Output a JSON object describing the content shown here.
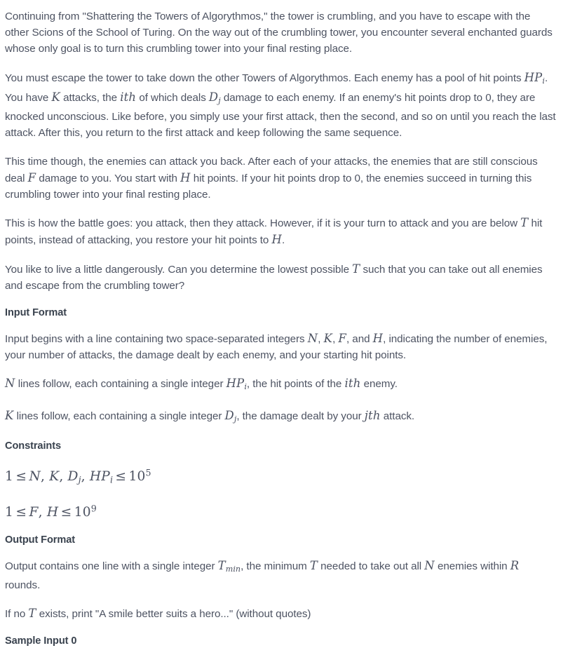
{
  "document": {
    "type": "programming-problem-statement",
    "body_color": "#4d5362",
    "heading_color": "#39424e",
    "background": "#ffffff"
  },
  "paragraphs": {
    "intro": "Continuing from \"Shattering the Towers of Algorythmos,\" the tower is crumbling, and you have to escape with the other Scions of the School of Turing. On the way out of the crumbling tower, you encounter several enchanted guards whose only goal is to turn this crumbling tower into your final resting place.",
    "mechanics_1": "You must escape the tower to take down the other Towers of Algorythmos. Each enemy has a pool of hit points ",
    "mechanics_2": ". You have ",
    "mechanics_3": " attacks, the ",
    "mechanics_4": " of which deals ",
    "mechanics_5": " damage to each enemy. If an enemy's hit points drop to 0, they are knocked unconscious. Like before, you simply use your first attack, then the second, and so on until you reach the last attack. After this, you return to the first attack and keep following the same sequence.",
    "enemies_1": "This time though, the enemies can attack you back. After each of your attacks, the enemies that are still conscious deal ",
    "enemies_2": " damage to you. You start with ",
    "enemies_3": " hit points. If your hit points drop to 0, the enemies succeed in turning this crumbling tower into your final resting place.",
    "battle_1": "This is how the battle goes: you attack, then they attack. However, if it is your turn to attack and you are below ",
    "battle_2": " hit points, instead of attacking, you restore your hit points to ",
    "battle_3": ".",
    "question_1": "You like to live a little dangerously. Can you determine the lowest possible ",
    "question_2": " such that you can take out all enemies and escape from the crumbling tower?"
  },
  "input_format": {
    "heading": "Input Format",
    "line1_a": "Input begins with a line containing two space-separated integers ",
    "line1_b": ", ",
    "line1_c": ", ",
    "line1_d": ", and ",
    "line1_e": ", indicating the number of enemies, your number of attacks, the damage dealt by each enemy, and your starting hit points.",
    "line2_a": " lines follow, each containing a single integer ",
    "line2_b": ", the hit points of the ",
    "line2_c": " enemy.",
    "line3_a": " lines follow, each containing a single integer ",
    "line3_b": ", the damage dealt by your ",
    "line3_c": " attack."
  },
  "constraints": {
    "heading": "Constraints",
    "line1": {
      "lower": "1",
      "vars": "N, K, D_j, HP_i",
      "upper_base": "10",
      "upper_exp": "5"
    },
    "line2": {
      "lower": "1",
      "vars": "F, H",
      "upper_base": "10",
      "upper_exp": "9"
    }
  },
  "output_format": {
    "heading": "Output Format",
    "line1_a": "Output contains one line with a single integer ",
    "line1_b": ", the minimum ",
    "line1_c": " needed to take out all ",
    "line1_d": " enemies within ",
    "line1_e": " rounds.",
    "line2_a": "If no ",
    "line2_b": " exists, print \"A smile better suits a hero...\" (without quotes)"
  },
  "sample": {
    "heading": "Sample Input 0"
  },
  "symbols": {
    "N": "N",
    "K": "K",
    "F": "F",
    "H": "H",
    "T": "T",
    "R": "R",
    "D": "D",
    "j": "j",
    "i": "i",
    "HP": "HP",
    "ith": "ith",
    "jth": "jth",
    "T_min_base": "T",
    "T_min_sub": "min",
    "leq": "≤",
    "comma": ","
  }
}
